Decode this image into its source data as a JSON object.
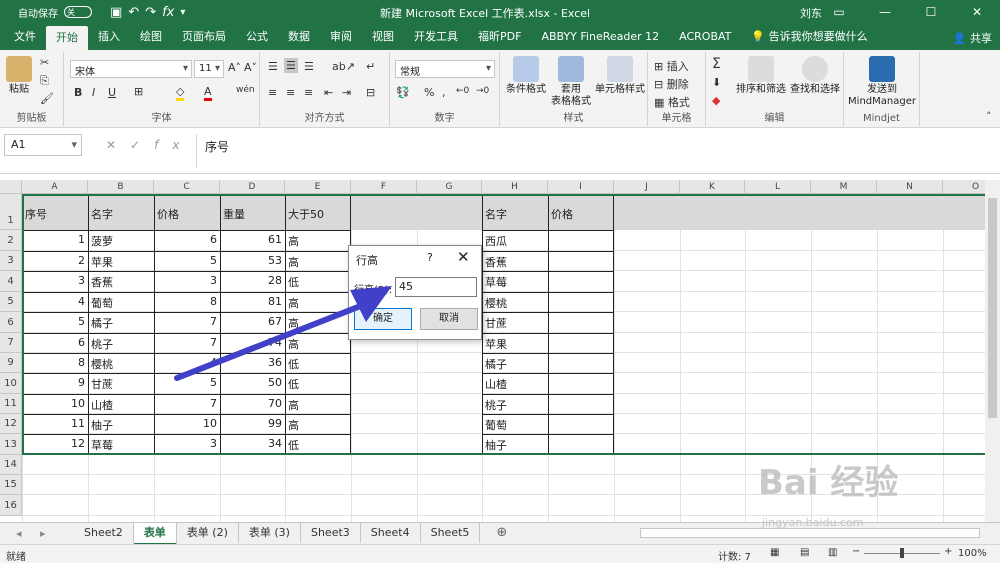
{
  "titlebar": {
    "autosave": "自动保存",
    "autosave_state": "关",
    "title": "新建 Microsoft Excel 工作表.xlsx  -  Excel",
    "user": "刘东"
  },
  "tabs": [
    "文件",
    "开始",
    "插入",
    "绘图",
    "页面布局",
    "公式",
    "数据",
    "审阅",
    "视图",
    "开发工具",
    "福昕PDF",
    "ABBYY FineReader 12",
    "ACROBAT",
    "告诉我你想要做什么"
  ],
  "share": "共享",
  "ribbon": {
    "clipboard": {
      "paste": "粘贴",
      "label": "剪贴板"
    },
    "font": {
      "name": "宋体",
      "size": "11",
      "label": "字体"
    },
    "align": {
      "label": "对齐方式"
    },
    "number": {
      "format": "常规",
      "label": "数字"
    },
    "styles": {
      "cond": "条件格式",
      "table": "套用\n表格格式",
      "cell": "单元格样式",
      "label": "样式"
    },
    "cells": {
      "insert": "插入",
      "delete": "删除",
      "format": "格式",
      "label": "单元格"
    },
    "edit": {
      "sort": "排序和筛选",
      "find": "查找和选择",
      "label": "编辑"
    },
    "mindjet": {
      "send": "发送到\nMindManager",
      "label": "Mindjet"
    }
  },
  "formula": {
    "namebox": "A1",
    "content": "序号"
  },
  "columns": [
    "A",
    "B",
    "C",
    "D",
    "E",
    "F",
    "G",
    "H",
    "I",
    "J",
    "K",
    "L",
    "M",
    "N",
    "O"
  ],
  "rows": [
    "1",
    "2",
    "3",
    "4",
    "5",
    "6",
    "7",
    "9",
    "10",
    "11",
    "12",
    "13",
    "14",
    "15",
    "16"
  ],
  "headers": {
    "a": "序号",
    "b": "名字",
    "c": "价格",
    "d": "重量",
    "e": "大于50",
    "h": "名字",
    "i": "价格"
  },
  "table": [
    {
      "n": "1",
      "name": "菠萝",
      "price": "6",
      "weight": "61",
      "flag": "高"
    },
    {
      "n": "2",
      "name": "苹果",
      "price": "5",
      "weight": "53",
      "flag": "高"
    },
    {
      "n": "3",
      "name": "香蕉",
      "price": "3",
      "weight": "28",
      "flag": "低"
    },
    {
      "n": "4",
      "name": "葡萄",
      "price": "8",
      "weight": "81",
      "flag": "高"
    },
    {
      "n": "5",
      "name": "橘子",
      "price": "7",
      "weight": "67",
      "flag": "高"
    },
    {
      "n": "6",
      "name": "桃子",
      "price": "7",
      "weight": "74",
      "flag": "高"
    },
    {
      "n": "8",
      "name": "樱桃",
      "price": "4",
      "weight": "36",
      "flag": "低"
    },
    {
      "n": "9",
      "name": "甘蔗",
      "price": "5",
      "weight": "50",
      "flag": "低"
    },
    {
      "n": "10",
      "name": "山楂",
      "price": "7",
      "weight": "70",
      "flag": "高"
    },
    {
      "n": "11",
      "name": "柚子",
      "price": "10",
      "weight": "99",
      "flag": "高"
    },
    {
      "n": "12",
      "name": "草莓",
      "price": "3",
      "weight": "34",
      "flag": "低"
    }
  ],
  "hlist": [
    "西瓜",
    "香蕉",
    "草莓",
    "樱桃",
    "甘蔗",
    "苹果",
    "橘子",
    "山楂",
    "桃子",
    "葡萄",
    "柚子"
  ],
  "dialog": {
    "title": "行高",
    "help": "?",
    "close": "✕",
    "label": "行高(R):",
    "value": "45",
    "ok": "确定",
    "cancel": "取消"
  },
  "sheets": [
    "Sheet2",
    "表单",
    "表单 (2)",
    "表单 (3)",
    "Sheet3",
    "Sheet4",
    "Sheet5"
  ],
  "status": {
    "ready": "就绪",
    "count": "计数: 7",
    "zoom": "100%"
  },
  "watermark": {
    "brand": "Bai 经验",
    "url": "jingyan.baidu.com"
  },
  "colors": {
    "excel_green": "#217346",
    "arrow": "#4040c8"
  }
}
